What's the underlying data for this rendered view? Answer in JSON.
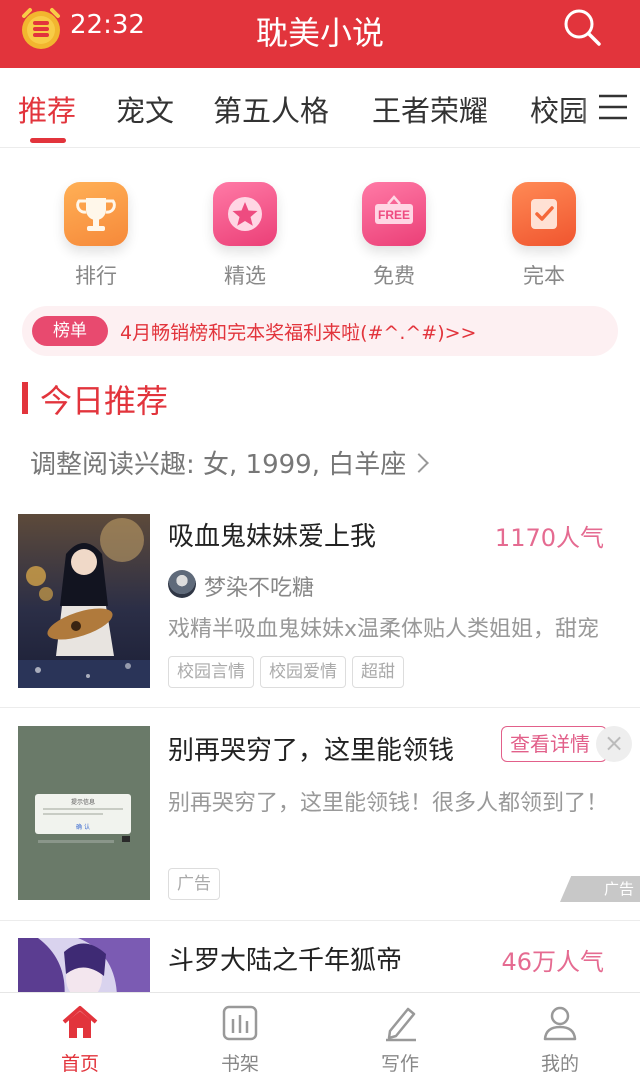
{
  "status_bar": {
    "time": "22:32"
  },
  "header": {
    "title": "耽美小说"
  },
  "tabs": [
    {
      "label": "推荐",
      "active": true
    },
    {
      "label": "宠文"
    },
    {
      "label": "第五人格"
    },
    {
      "label": "王者荣耀"
    },
    {
      "label": "校园"
    }
  ],
  "features": [
    {
      "label": "排行",
      "icon": "trophy-icon",
      "color": "#f6913c"
    },
    {
      "label": "精选",
      "icon": "star-icon",
      "color": "#ee4b80"
    },
    {
      "label": "免费",
      "icon": "free-icon",
      "color": "#ee4b80",
      "text": "FREE"
    },
    {
      "label": "完本",
      "icon": "check-icon",
      "color": "#f5683a"
    }
  ],
  "notice": {
    "badge": "榜单",
    "text": "4月畅销榜和完本奖福利来啦(#^.^#)>>"
  },
  "section": {
    "title": "今日推荐"
  },
  "interest": {
    "text": "调整阅读兴趣: 女, 1999, 白羊座"
  },
  "books": [
    {
      "title": "吸血鬼妹妹爱上我",
      "popularity": "1170人气",
      "author": "梦染不吃糖",
      "desc": "戏精半吸血鬼妹妹x温柔体贴人类姐姐，甜宠",
      "tags": [
        "校园言情",
        "校园爱情",
        "超甜"
      ]
    },
    {
      "title": "别再哭穷了，这里能领钱",
      "button": "查看详情",
      "desc": "别再哭穷了，这里能领钱！很多人都领到了！",
      "tags": [
        "广告"
      ],
      "ad_label": "广告",
      "cover_dialog": {
        "title": "提示信息",
        "button": "确 认"
      }
    },
    {
      "title": "斗罗大陆之千年狐帝",
      "popularity": "46万人气"
    }
  ],
  "nav": [
    {
      "label": "首页",
      "icon": "home-icon",
      "active": true
    },
    {
      "label": "书架",
      "icon": "bookshelf-icon"
    },
    {
      "label": "写作",
      "icon": "pencil-icon"
    },
    {
      "label": "我的",
      "icon": "user-icon"
    }
  ],
  "colors": {
    "brand": "#e2343c",
    "popularity": "#e56b91",
    "ad_cover": "#6a7a69"
  }
}
